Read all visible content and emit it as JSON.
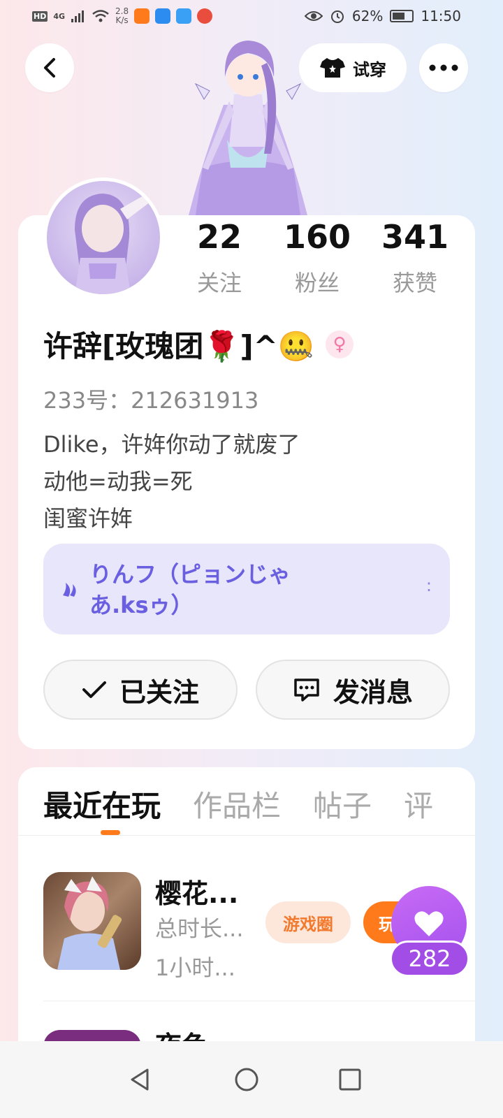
{
  "status_bar": {
    "network_label": "HD",
    "signal_label": "4G",
    "net_speed_value": "2.8",
    "net_speed_unit": "K/s",
    "battery": "62%",
    "time": "11:50"
  },
  "header": {
    "try_on_label": "试穿"
  },
  "profile": {
    "stats": [
      {
        "value": "22",
        "label": "关注"
      },
      {
        "value": "160",
        "label": "粉丝"
      },
      {
        "value": "341",
        "label": "获赞"
      }
    ],
    "username": "许辞[玫瑰团🌹]^🤐",
    "gender_symbol": "♀",
    "uid": "233号：212631913",
    "bio": [
      "Dlike，许姩你动了就废了",
      "动他=动我=死",
      "闺蜜许姩"
    ],
    "music_title": "りんフ（ピョンじゃあ.ksゥ）",
    "music_extra": ":",
    "follow_label": "已关注",
    "message_label": "发消息"
  },
  "tabs": [
    {
      "label": "最近在玩",
      "active": true
    },
    {
      "label": "作品栏",
      "active": false
    },
    {
      "label": "帖子",
      "active": false
    },
    {
      "label": "评",
      "active": false
    }
  ],
  "games": [
    {
      "title": "樱花...",
      "total_time_label": "总时长...",
      "time": "1小时...",
      "tag_circle": "游戏圈",
      "tag_play": "玩"
    },
    {
      "title": "夜色"
    }
  ],
  "like": {
    "count": "282"
  },
  "colors": {
    "accent_orange": "#ff7a1a",
    "accent_purple": "#a451ee",
    "music_text": "#6a5fe0"
  }
}
